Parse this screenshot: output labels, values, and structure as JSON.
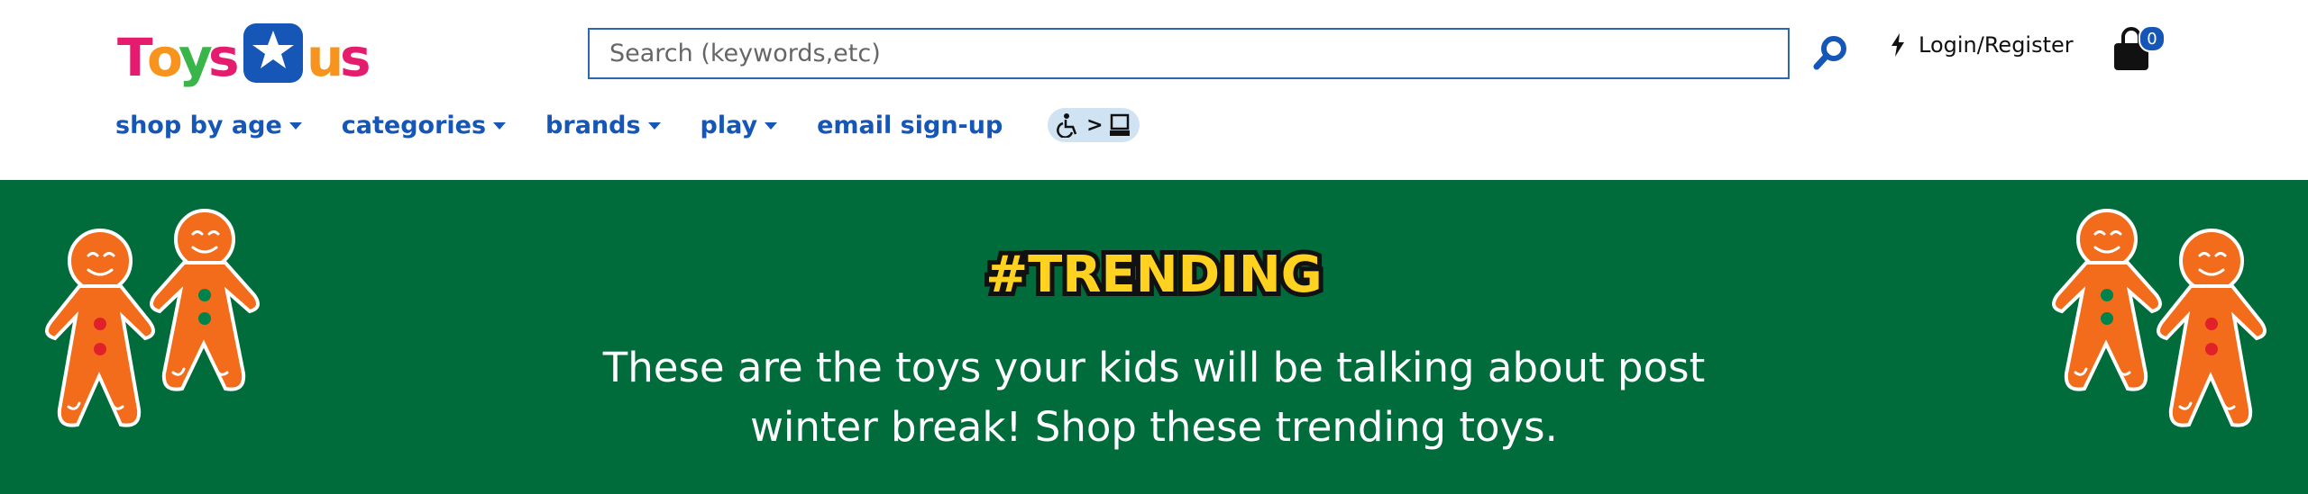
{
  "header": {
    "logo_text": "TOYSRUS",
    "search": {
      "placeholder": "Search (keywords,etc)",
      "value": ""
    },
    "login_label": "Login/Register",
    "cart_count": "0",
    "accent_color": "#1656b6"
  },
  "nav": {
    "items": [
      {
        "label": "shop by age",
        "dropdown": true
      },
      {
        "label": "categories",
        "dropdown": true
      },
      {
        "label": "brands",
        "dropdown": true
      },
      {
        "label": "play",
        "dropdown": true
      },
      {
        "label": "email sign-up",
        "dropdown": false
      }
    ],
    "accessibility_separator": ">"
  },
  "banner": {
    "headline": "#TRENDING",
    "line1": "These are the toys your kids will be talking about post",
    "line2": "winter break! Shop these trending toys.",
    "background_color": "#006c3b",
    "headline_color": "#ffd21f"
  },
  "icons": [
    "search-icon",
    "bolt-icon",
    "shopping-bag-icon",
    "wheelchair-icon",
    "screen-reader-icon",
    "gingerbread-man-icon"
  ]
}
